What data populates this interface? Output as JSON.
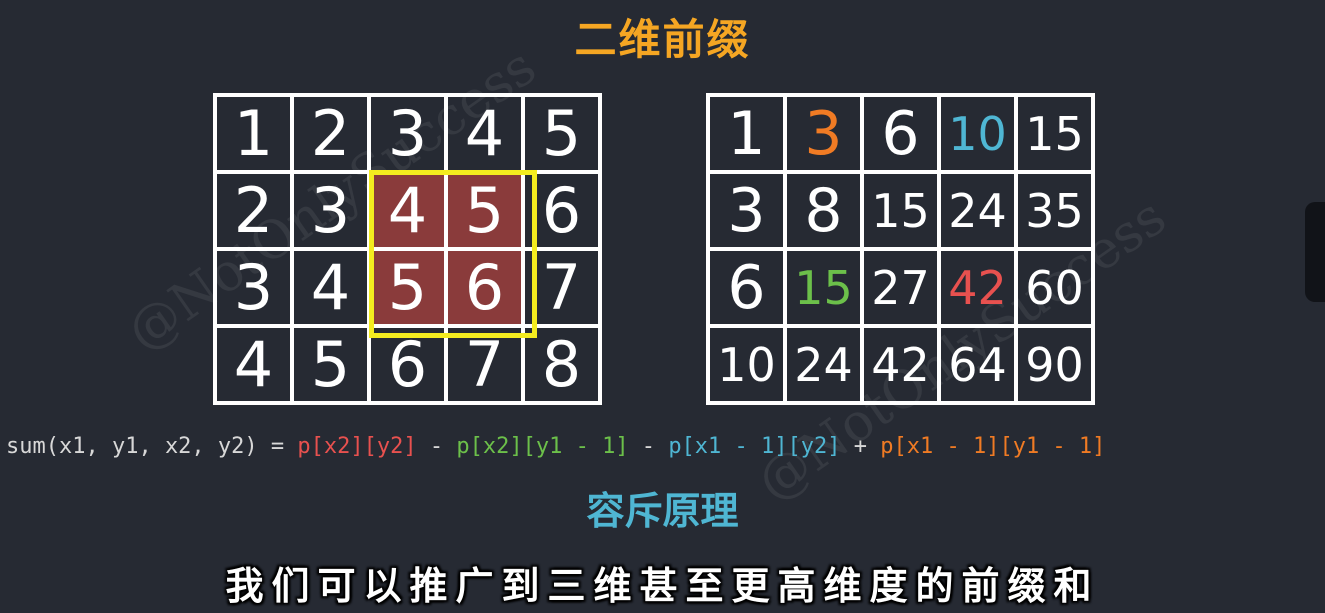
{
  "title": {
    "text": "二维前缀",
    "color": "#f5a623"
  },
  "left_grid": {
    "rows": [
      [
        "1",
        "2",
        "3",
        "4",
        "5"
      ],
      [
        "2",
        "3",
        "4",
        "5",
        "6"
      ],
      [
        "3",
        "4",
        "5",
        "6",
        "7"
      ],
      [
        "4",
        "5",
        "6",
        "7",
        "8"
      ]
    ],
    "highlight_color": "#8a3b3b",
    "selection_color": "#f4ec1f"
  },
  "right_grid": {
    "rows": [
      [
        "1",
        "3",
        "6",
        "10",
        "15"
      ],
      [
        "3",
        "8",
        "15",
        "24",
        "35"
      ],
      [
        "6",
        "15",
        "27",
        "42",
        "60"
      ],
      [
        "10",
        "24",
        "42",
        "64",
        "90"
      ]
    ],
    "accent_colors": {
      "orange": "#f07b24",
      "blue": "#4fb6d3",
      "green": "#6cc04a",
      "red": "#e8514f"
    }
  },
  "formula": {
    "prefix": "sum(x1, y1, x2, y2) = ",
    "term1": "p[x2][y2]",
    "op1": " - ",
    "term2": "p[x2][y1 - 1]",
    "op2": " - ",
    "term3": "p[x1 - 1][y2]",
    "op3": " + ",
    "term4": "p[x1 - 1][y1 - 1]"
  },
  "subtitle": {
    "text": "容斥原理",
    "color": "#4fb6d3"
  },
  "caption": "我们可以推广到三维甚至更高维度的前缀和",
  "watermark": "@NotOnlySuccess"
}
